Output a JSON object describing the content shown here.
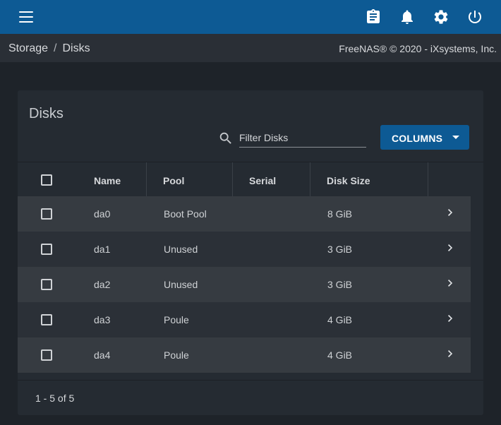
{
  "topbar": {
    "icons": [
      "menu-icon",
      "clipboard-icon",
      "bell-icon",
      "gear-icon",
      "power-icon"
    ],
    "color": "#0d5a94"
  },
  "breadcrumb": {
    "items": [
      "Storage",
      "Disks"
    ],
    "separator": "/"
  },
  "copyright": "FreeNAS® © 2020 - iXsystems, Inc.",
  "card": {
    "title": "Disks",
    "filter_placeholder": "Filter Disks",
    "columns_label": "COLUMNS"
  },
  "table": {
    "headers": [
      "Name",
      "Pool",
      "Serial",
      "Disk Size"
    ],
    "rows": [
      {
        "name": "da0",
        "pool": "Boot Pool",
        "serial": "",
        "size": "8 GiB"
      },
      {
        "name": "da1",
        "pool": "Unused",
        "serial": "",
        "size": "3 GiB"
      },
      {
        "name": "da2",
        "pool": "Unused",
        "serial": "",
        "size": "3 GiB"
      },
      {
        "name": "da3",
        "pool": "Poule",
        "serial": "",
        "size": "4 GiB"
      },
      {
        "name": "da4",
        "pool": "Poule",
        "serial": "",
        "size": "4 GiB"
      }
    ]
  },
  "pager": "1 - 5 of 5"
}
